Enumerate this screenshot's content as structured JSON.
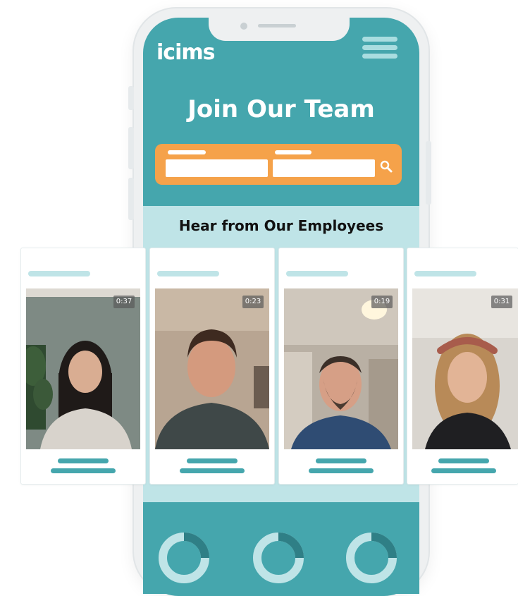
{
  "brand": {
    "logo_text": "icims"
  },
  "hero": {
    "title": "Join Our Team"
  },
  "employees": {
    "heading": "Hear from Our Employees",
    "videos": [
      {
        "duration": "0:37"
      },
      {
        "duration": "0:23"
      },
      {
        "duration": "0:19"
      },
      {
        "duration": "0:31"
      }
    ]
  },
  "colors": {
    "primary": "#45a6ad",
    "light": "#bfe4e7",
    "search_bar": "#f5a24a"
  },
  "icons": [
    "menu-icon",
    "search-icon"
  ]
}
